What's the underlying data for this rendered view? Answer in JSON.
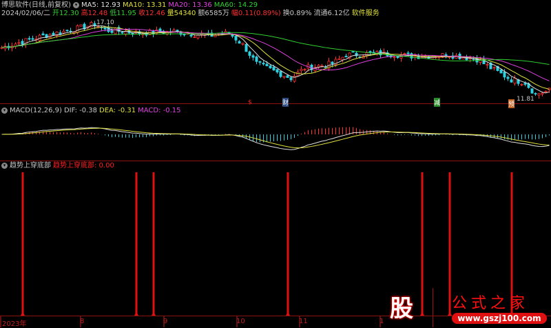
{
  "header": {
    "title": "博思软件(日线,前复权)",
    "ma5": "MA5: 12.93",
    "ma10": "MA10: 13.31",
    "ma20": "MA20: 13.36",
    "ma60": "MA60: 14.29",
    "date": "2024/02/06/二",
    "open": "开12.30",
    "high": "高12.48",
    "low": "低11.95",
    "close": "收12.46",
    "vol": "量54340",
    "amount": "额6585万",
    "change": "幅0.11(0.89%)",
    "turnover": "换0.89%",
    "float": "流通6.12亿",
    "sector": "软件服务"
  },
  "markers": {
    "high_label": "17.10",
    "low_label": "11.81",
    "m1": "$",
    "m2": "财",
    "m3": "减",
    "m4": "预"
  },
  "macd": {
    "title": "MACD(12,26,9)",
    "dif": "DIF: -0.38",
    "dea": "DEA: -0.31",
    "macd": "MACD: -0.15"
  },
  "indicator": {
    "title": "趋势上穿底部",
    "name": "趋势上穿底部",
    "value": ": 0.00"
  },
  "xaxis": [
    "2023年",
    "8",
    "9",
    "10",
    "11",
    "1"
  ],
  "logo": {
    "char": "股",
    "text": "公式之家",
    "url": "www.gszj100.com"
  },
  "colors": {
    "up": "#ff3030",
    "down": "#30d0e0",
    "ma5": "#e0e0e0",
    "ma10": "#e0e040",
    "ma20": "#e040e0",
    "ma60": "#30d030",
    "signal": "#e01010"
  },
  "chart_data": {
    "type": "candlestick",
    "bars": 160,
    "close_anchors": [
      [
        0,
        15.4
      ],
      [
        6,
        15.8
      ],
      [
        12,
        16.2
      ],
      [
        20,
        16.6
      ],
      [
        27,
        17.0
      ],
      [
        30,
        16.6
      ],
      [
        40,
        16.4
      ],
      [
        50,
        16.5
      ],
      [
        60,
        16.2
      ],
      [
        66,
        16.4
      ],
      [
        70,
        15.6
      ],
      [
        74,
        14.3
      ],
      [
        78,
        13.9
      ],
      [
        84,
        13.3
      ],
      [
        88,
        14.0
      ],
      [
        96,
        14.3
      ],
      [
        100,
        14.9
      ],
      [
        110,
        15.0
      ],
      [
        120,
        14.8
      ],
      [
        130,
        14.9
      ],
      [
        138,
        14.6
      ],
      [
        142,
        14.0
      ],
      [
        148,
        13.2
      ],
      [
        152,
        13.0
      ],
      [
        155,
        12.2
      ],
      [
        159,
        12.46
      ]
    ],
    "signal_bars": [
      6,
      39,
      44,
      83,
      122,
      130,
      148
    ],
    "xaxis_ticks": [
      "2023年",
      "8",
      "9",
      "10",
      "11",
      "1"
    ]
  }
}
